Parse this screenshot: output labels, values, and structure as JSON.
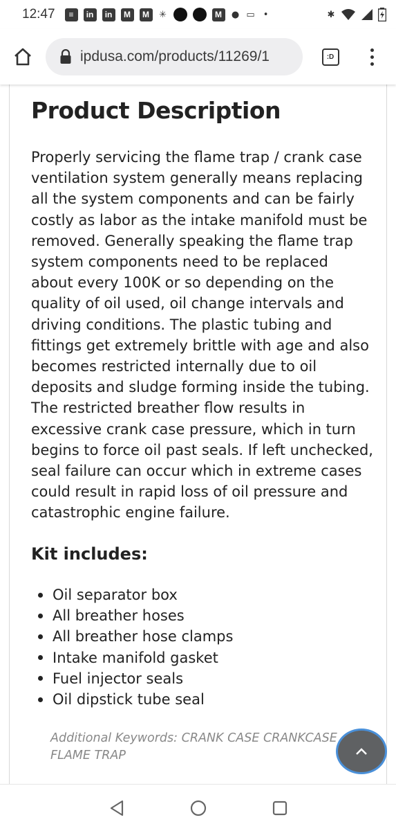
{
  "status_bar": {
    "time": "12:47",
    "left_icons": [
      "message-icon",
      "linkedin-icon",
      "linkedin-icon",
      "gmail-icon",
      "gmail-icon",
      "walmart-icon",
      "circle-icon",
      "circle-icon",
      "gmail-icon",
      "leaf-icon",
      "truck-icon",
      "dot-icon"
    ],
    "linkedin_label": "in",
    "right_icons": [
      "bluetooth-icon",
      "wifi-icon",
      "signal-icon",
      "battery-icon"
    ]
  },
  "browser": {
    "url": "ipdusa.com/products/11269/1",
    "tab_label": ":D"
  },
  "product": {
    "heading": "Product Description",
    "description": "Properly servicing the flame trap / crank case ventilation system generally means replacing all the system components and can be fairly costly as labor as the intake manifold must be removed. Generally speaking the flame trap system components need to be replaced about every 100K or so depending on the quality of oil used, oil change intervals and driving conditions. The plastic tubing and fittings get extremely brittle with age and also becomes restricted internally due to oil deposits and sludge forming inside the tubing. The restricted breather flow results in excessive crank case pressure, which in turn begins to force oil past seals. If left unchecked, seal failure can occur which in extreme cases could result in rapid loss of oil pressure and catastrophic engine failure.",
    "kit_heading": "Kit includes:",
    "kit_items": [
      "Oil separator box",
      "All breather hoses",
      "All breather hose clamps",
      "Intake manifold gasket",
      "Fuel injector seals",
      "Oil dipstick tube seal"
    ],
    "keywords": "Additional Keywords: CRANK CASE CRANKCASE FLAME TRAP"
  },
  "colors": {
    "accent_ring": "#4a90d9",
    "scroll_button": "#5f6163",
    "keywords_text": "#888888"
  }
}
